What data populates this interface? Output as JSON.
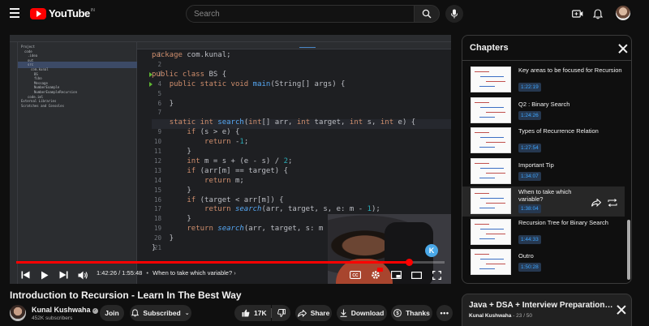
{
  "colors": {
    "bg": "#0f0f0f",
    "accent": "#ff0000",
    "chip": "#272727",
    "timestamp": "#3ea6ff"
  },
  "header": {
    "logo_text": "YouTube",
    "country_code": "IN",
    "search_placeholder": "Search",
    "icons": [
      "menu-icon",
      "search-icon",
      "mic-icon",
      "create-icon",
      "bell-icon",
      "avatar"
    ]
  },
  "player": {
    "code_lines": [
      {
        "n": "1",
        "html": "<span class='k'>package</span> com.kunal;"
      },
      {
        "n": "2",
        "html": ""
      },
      {
        "n": "3",
        "html": "<span class='k'>public class</span> BS {"
      },
      {
        "n": "4",
        "html": "    <span class='k'>public static void</span> <span class='fn'>main</span>(String[] args) {"
      },
      {
        "n": "5",
        "html": ""
      },
      {
        "n": "6",
        "html": "    }"
      },
      {
        "n": "7",
        "html": ""
      },
      {
        "n": "8",
        "html": "    <span class='k'>static int</span> <span class='fn'>search</span>(<span class='k'>int</span>[] arr, <span class='k'>int</span> target, <span class='k'>int</span> s, <span class='k'>int</span> e) {"
      },
      {
        "n": "9",
        "html": "        <span class='k'>if</span> (s &gt; e) {"
      },
      {
        "n": "10",
        "html": "            <span class='k'>return</span> -<span class='num'>1</span>;"
      },
      {
        "n": "11",
        "html": "        }"
      },
      {
        "n": "12",
        "html": "        <span class='k'>int</span> m = s + (e - s) / <span class='num'>2</span>;"
      },
      {
        "n": "13",
        "html": "        <span class='k'>if</span> (arr[m] == target) {"
      },
      {
        "n": "14",
        "html": "            <span class='k'>return</span> m;"
      },
      {
        "n": "15",
        "html": "        }"
      },
      {
        "n": "16",
        "html": "        <span class='k'>if</span> (target &lt; arr[m]) {"
      },
      {
        "n": "17",
        "html": "            <span class='k'>return</span> <span class='it'>search</span>(arr, target, s, e: m - <span class='num'>1</span>);"
      },
      {
        "n": "18",
        "html": "        }"
      },
      {
        "n": "19",
        "html": "        <span class='k'>return</span> <span class='it'>search</span>(arr, target, s: m + <span class='num'>1</span>, e);"
      },
      {
        "n": "20",
        "html": "    }"
      },
      {
        "n": "21",
        "html": "}"
      }
    ],
    "tree_items": [
      "Project",
      "code",
      ".idea",
      "out",
      "src",
      "com.kunal",
      "BS",
      "fibo",
      "Message",
      "NumberExample",
      "NumberExampleRecursion",
      "code.iml",
      "External Libraries",
      "Scratches and Consoles"
    ],
    "progress_fraction": 0.917,
    "time_current": "1:42:26",
    "time_total": "1:55:48",
    "current_chapter": "When to take which variable?",
    "webcam_logo": "K"
  },
  "video": {
    "title": "Introduction to Recursion - Learn In The Best Way",
    "channel": "Kunal Kushwaha",
    "subscribers": "452K subscribers",
    "join_label": "Join",
    "subscribed_label": "Subscribed",
    "likes": "17K",
    "share_label": "Share",
    "download_label": "Download",
    "thanks_label": "Thanks"
  },
  "chapters": {
    "title": "Chapters",
    "items": [
      {
        "name": "Key areas to be focused for Recursion",
        "time": "1:22:19",
        "active": false
      },
      {
        "name": "Q2 : Binary Search",
        "time": "1:24:26",
        "active": false
      },
      {
        "name": "Types of Recurrence Relation",
        "time": "1:27:54",
        "active": false
      },
      {
        "name": "Important Tip",
        "time": "1:34:07",
        "active": false
      },
      {
        "name": "When to take which variable?",
        "time": "1:38:04",
        "active": true
      },
      {
        "name": "Recursion Tree for Binary Search",
        "time": "1:44:33",
        "active": false
      },
      {
        "name": "Outro",
        "time": "1:50:28",
        "active": false
      }
    ]
  },
  "playlist": {
    "title": "Java + DSA + Interview Preparation C…",
    "author": "Kunal Kushwaha",
    "position": "- 23 / 50"
  }
}
